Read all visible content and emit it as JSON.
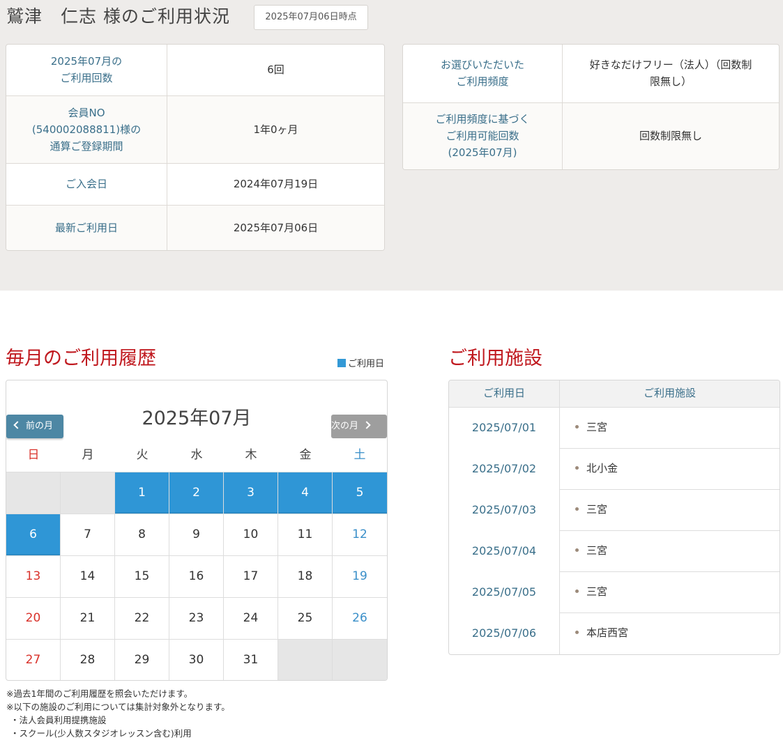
{
  "header": {
    "member_name": "鷲津　仁志 様のご利用状況",
    "as_of": "2025年07月06日時点"
  },
  "summary_left": [
    {
      "label": "2025年07月の\nご利用回数",
      "value": "6回"
    },
    {
      "label": "会員NO\n(540002088811)様の\n通算ご登録期間",
      "value": "1年0ヶ月"
    },
    {
      "label": "ご入会日",
      "value": "2024年07月19日"
    },
    {
      "label": "最新ご利用日",
      "value": "2025年07月06日"
    }
  ],
  "summary_right": [
    {
      "label": "お選びいただいた\nご利用頻度",
      "value": "好きなだけフリー（法人）（回数制\n限無し）"
    },
    {
      "label": "ご利用頻度に基づく\nご利用可能回数\n(2025年07月)",
      "value": "回数制限無し"
    }
  ],
  "history": {
    "title": "毎月のご利用履歴",
    "legend": "ご利用日",
    "month": "2025年07月",
    "prev_label": "前の月",
    "next_label": "次の月",
    "weekdays": [
      "日",
      "月",
      "火",
      "水",
      "木",
      "金",
      "土"
    ],
    "weeks": [
      [
        "",
        "",
        "1",
        "2",
        "3",
        "4",
        "5"
      ],
      [
        "6",
        "7",
        "8",
        "9",
        "10",
        "11",
        "12"
      ],
      [
        "13",
        "14",
        "15",
        "16",
        "17",
        "18",
        "19"
      ],
      [
        "20",
        "21",
        "22",
        "23",
        "24",
        "25",
        "26"
      ],
      [
        "27",
        "28",
        "29",
        "30",
        "31",
        "",
        ""
      ]
    ],
    "used_days": [
      "1",
      "2",
      "3",
      "4",
      "5",
      "6"
    ],
    "used_color": "#2f96d6",
    "notes": [
      "※過去1年間のご利用履歴を照会いただけます。",
      "※以下の施設のご利用については集計対象外となります。",
      "・法人会員利用提携施設",
      "・スクール(少人数スタジオレッスン含む)利用"
    ]
  },
  "facilities": {
    "title": "ご利用施設",
    "col_date": "ご利用日",
    "col_facility": "ご利用施設",
    "rows": [
      {
        "date": "2025/07/01",
        "facility": "三宮"
      },
      {
        "date": "2025/07/02",
        "facility": "北小金"
      },
      {
        "date": "2025/07/03",
        "facility": "三宮"
      },
      {
        "date": "2025/07/04",
        "facility": "三宮"
      },
      {
        "date": "2025/07/05",
        "facility": "三宮"
      },
      {
        "date": "2025/07/06",
        "facility": "本店西宮"
      }
    ]
  },
  "colors": {
    "heading_red": "#c0191f",
    "label_blue": "#3a6f8a",
    "sunday": "#d9322b",
    "saturday": "#3a8fc9"
  }
}
